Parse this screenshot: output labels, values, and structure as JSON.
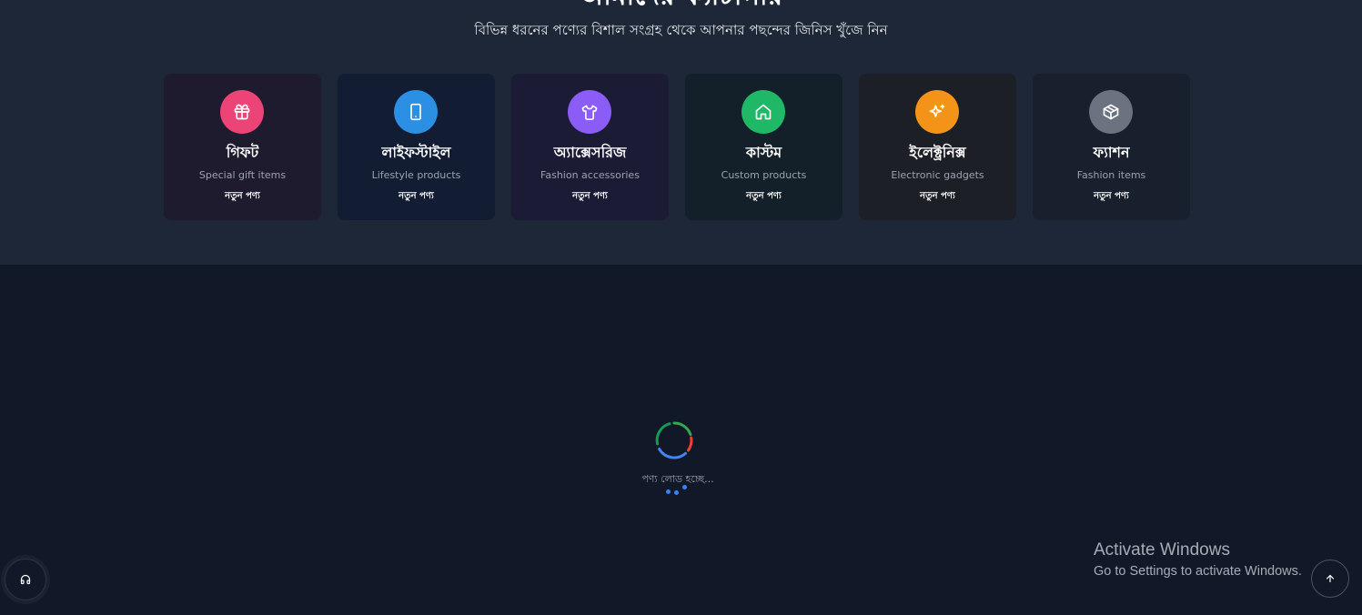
{
  "categories_section": {
    "title": "আমাদের ক্যাটাগরি",
    "subtitle": "বিভিন্ন ধরনের পণ্যের বিশাল সংগ্রহ থেকে আপনার পছন্দের জিনিস খুঁজে নিন",
    "cards": [
      {
        "name": "গিফট",
        "description": "Special gift items",
        "badge": "নতুন পণ্য",
        "icon": "gift-icon",
        "icon_color": "#ec4477",
        "card_bg": "#1e1b2e"
      },
      {
        "name": "লাইফস্টাইল",
        "description": "Lifestyle products",
        "badge": "নতুন পণ্য",
        "icon": "smartphone-icon",
        "icon_color": "#2b8fe4",
        "card_bg": "#121d33"
      },
      {
        "name": "অ্যাক্সেসরিজ",
        "description": "Fashion accessories",
        "badge": "নতুন পণ্য",
        "icon": "shirt-icon",
        "icon_color": "#8b5cf6",
        "card_bg": "#1b1b36"
      },
      {
        "name": "কাস্টম",
        "description": "Custom products",
        "badge": "নতুন পণ্য",
        "icon": "home-icon",
        "icon_color": "#1fb866",
        "card_bg": "#132029"
      },
      {
        "name": "ইলেক্ট্রনিক্স",
        "description": "Electronic gadgets",
        "badge": "নতুন পণ্য",
        "icon": "sparkles-icon",
        "icon_color": "#f39418",
        "card_bg": "#1d1f27"
      },
      {
        "name": "ফ্যাশন",
        "description": "Fashion items",
        "badge": "নতুন পণ্য",
        "icon": "box-icon",
        "icon_color": "#6b7280",
        "card_bg": "#181f2d"
      }
    ]
  },
  "loading": {
    "text": "পণ্য লোড হচ্ছে...",
    "spinner_colors": [
      "#34a853",
      "#ea4335",
      "#4285f4",
      "#fbbc05"
    ],
    "dot_color": "#3b82f6"
  },
  "watermark": {
    "title": "Activate Windows",
    "subtitle": "Go to Settings to activate Windows."
  },
  "floating": {
    "support_icon": "headphones-icon",
    "top_icon": "arrow-up-icon"
  }
}
